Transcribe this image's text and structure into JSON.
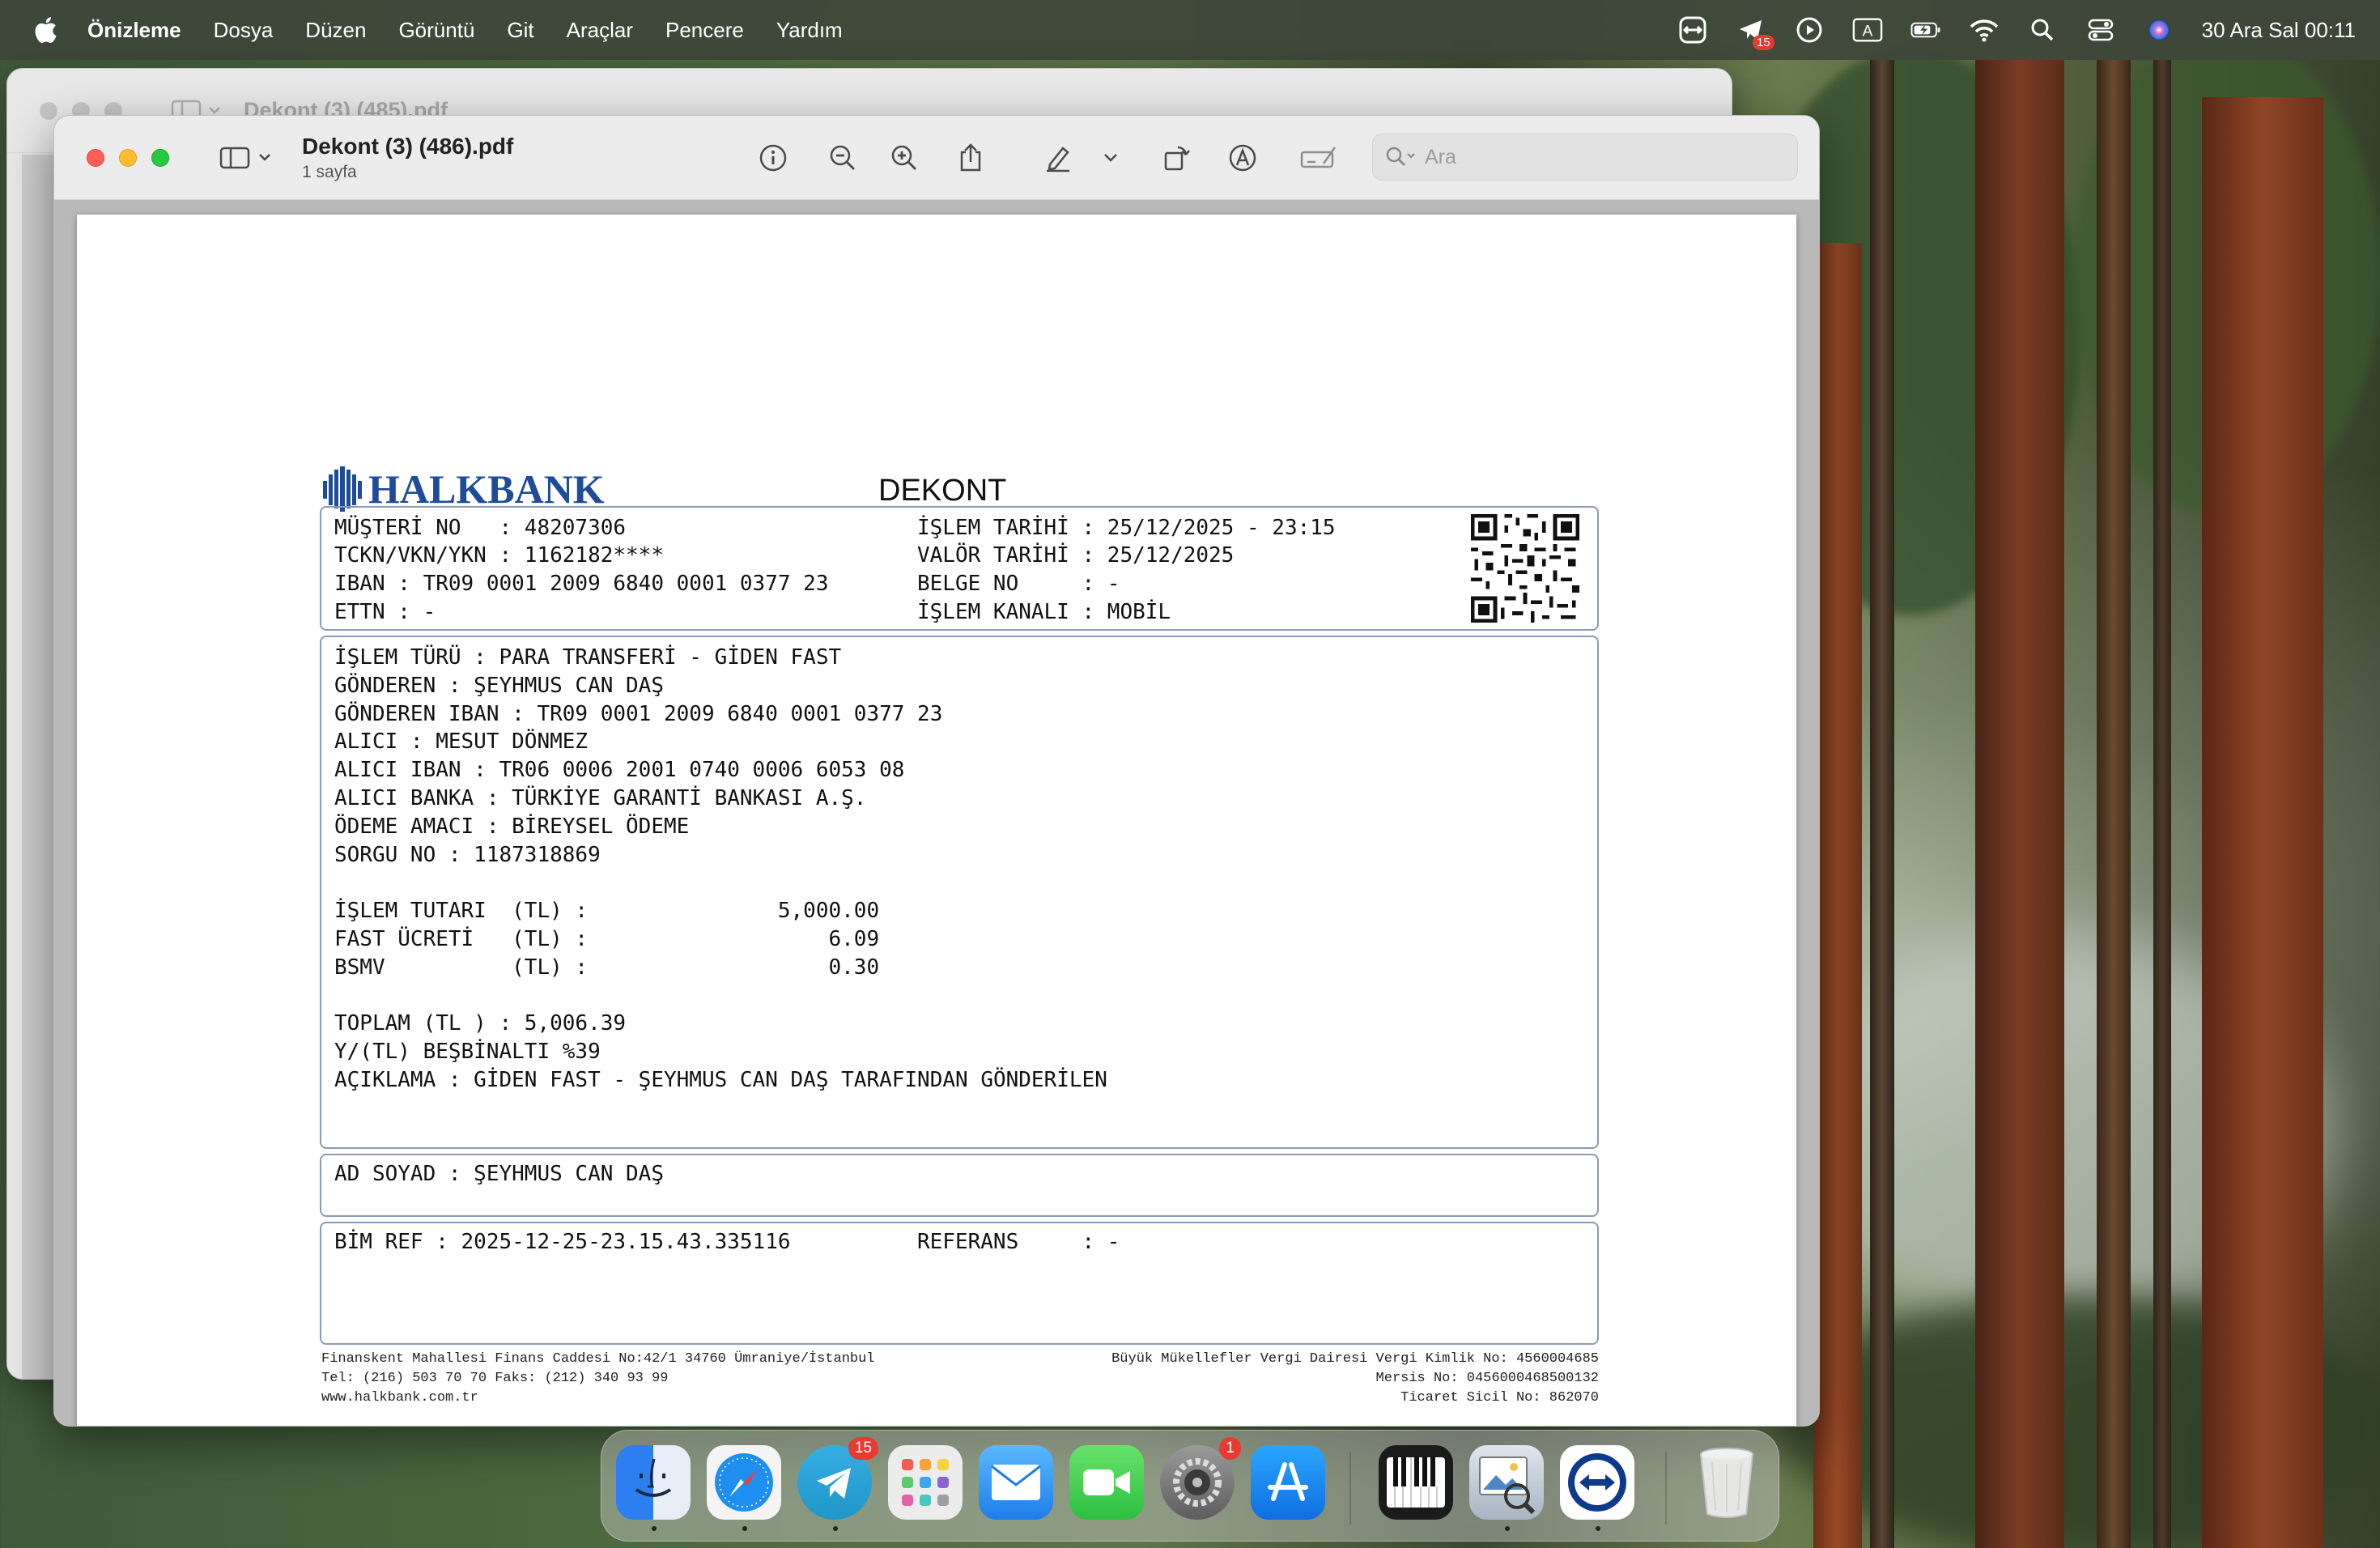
{
  "menubar": {
    "app": "Önizleme",
    "items": [
      "Dosya",
      "Düzen",
      "Görüntü",
      "Git",
      "Araçlar",
      "Pencere",
      "Yardım"
    ],
    "notification_badge": "15",
    "clock": "30 Ara Sal  00:11"
  },
  "back_window": {
    "title": "Dekont (3) (485).pdf",
    "search_placeholder": "Ara"
  },
  "window": {
    "title": "Dekont (3) (486).pdf",
    "subtitle": "1 sayfa",
    "search_placeholder": "Ara"
  },
  "document": {
    "bank_name": "HALKBANK",
    "doc_title": "DEKONT",
    "header_left": [
      "MÜŞTERİ NO   : 48207306",
      "TCKN/VKN/YKN : 1162182****",
      "IBAN : TR09 0001 2009 6840 0001 0377 23",
      "ETTN : -"
    ],
    "header_right": [
      "İŞLEM TARİHİ : 25/12/2025 - 23:15",
      "VALÖR TARİHİ : 25/12/2025",
      "BELGE NO     : -",
      "İŞLEM KANALI : MOBİL"
    ],
    "details": [
      "İŞLEM TÜRÜ : PARA TRANSFERİ - GİDEN FAST",
      "GÖNDEREN : ŞEYHMUS CAN DAŞ",
      "GÖNDEREN IBAN : TR09 0001 2009 6840 0001 0377 23",
      "ALICI : MESUT DÖNMEZ",
      "ALICI IBAN : TR06 0006 2001 0740 0006 6053 08",
      "ALICI BANKA : TÜRKİYE GARANTİ BANKASI A.Ş.",
      "ÖDEME AMACI : BİREYSEL ÖDEME",
      "SORGU NO : 1187318869",
      "",
      "İŞLEM TUTARI  (TL) :               5,000.00",
      "FAST ÜCRETİ   (TL) :                   6.09",
      "BSMV          (TL) :                   0.30",
      "",
      "TOPLAM (TL ) : 5,006.39",
      "Y/(TL) BEŞBİNALTI %39",
      "AÇIKLAMA : GİDEN FAST - ŞEYHMUS CAN DAŞ TARAFINDAN GÖNDERİLEN"
    ],
    "ad_soyad": "AD SOYAD : ŞEYHMUS CAN DAŞ",
    "bim_ref": "BİM REF : 2025-12-25-23.15.43.335116",
    "referans": "REFERANS     : -",
    "footer_left": [
      "Finanskent Mahallesi Finans Caddesi No:42/1 34760 Ümraniye/İstanbul",
      "Tel: (216) 503 70 70 Faks: (212) 340 93 99",
      "www.halkbank.com.tr"
    ],
    "footer_right": [
      "Büyük Mükellefler Vergi Dairesi Vergi Kimlik No: 4560004685",
      "Mersis No: 0456000468500132",
      "Ticaret Sicil No: 862070"
    ]
  },
  "dock": {
    "telegram_badge": "15",
    "settings_badge": "1"
  },
  "colors": {
    "brand_blue": "#1f4c99",
    "box_border": "#8a9bb8"
  }
}
